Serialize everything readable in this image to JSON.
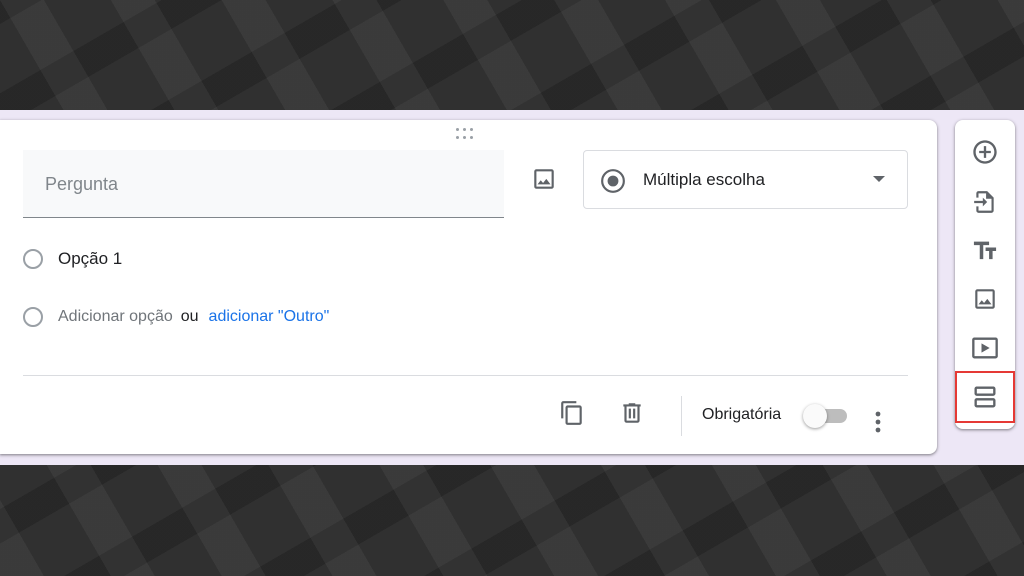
{
  "question": {
    "placeholder": "Pergunta"
  },
  "type_select": {
    "value": "Múltipla escolha"
  },
  "options": [
    {
      "label": "Opção 1"
    }
  ],
  "add_option": {
    "label": "Adicionar opção",
    "separator": "ou",
    "add_other_label": "adicionar \"Outro\""
  },
  "footer": {
    "required_label": "Obrigatória",
    "required_on": false
  },
  "icons": {
    "image": "image-icon",
    "radio_selected": "radio-checked-icon",
    "dropdown": "caret-down-icon",
    "duplicate": "copy-icon",
    "delete": "trash-icon",
    "more": "more-vert-icon",
    "add_question": "add-circle-icon",
    "import": "import-icon",
    "title": "text-title-icon",
    "add_image": "image-icon",
    "add_video": "video-icon",
    "add_section": "section-icon"
  },
  "colors": {
    "accent": "#1a73e8",
    "stage_bg": "#ede7f6",
    "highlight": "#e53935"
  }
}
